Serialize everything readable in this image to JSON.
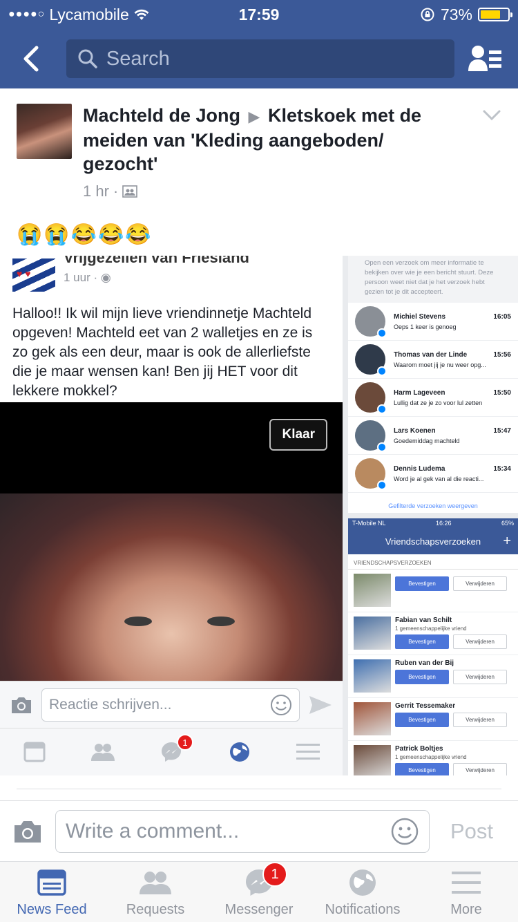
{
  "status_bar": {
    "carrier": "Lycamobile",
    "time": "17:59",
    "battery": "73%",
    "battery_level": 0.73
  },
  "nav": {
    "search_placeholder": "Search"
  },
  "post": {
    "author": "Machteld de Jong",
    "target": "Kletskoek met de meiden van 'Kleding aangeboden/ gezocht'",
    "time": "1 hr",
    "emojis": "😭😭😂😂😂"
  },
  "embedded_post": {
    "group": "Vrijgezellen van Friesland",
    "time": "1 uur",
    "text": "Halloo!! Ik wil mijn lieve vriendinnetje Machteld opgeven! Machteld eet van 2 walletjes en ze is zo gek als een deur, maar is ook de allerliefste die je maar wensen kan! Ben jij HET voor dit lekkere mokkel?",
    "klaar": "Klaar",
    "comment_placeholder": "Reactie schrijven...",
    "messenger_badge": "1"
  },
  "messages_panel": {
    "note": "Open een verzoek om meer informatie te bekijken over wie je een bericht stuurt. Deze persoon weet niet dat je het verzoek hebt gezien tot je dit accepteert.",
    "items": [
      {
        "name": "Michiel Stevens",
        "time": "16:05",
        "text": "Oeps 1 keer is genoeg",
        "color": "#8a8f96"
      },
      {
        "name": "Thomas van der Linde",
        "time": "15:56",
        "text": "Waarom moet jij je nu weer opg...",
        "color": "#2f3a4a"
      },
      {
        "name": "Harm Lageveen",
        "time": "15:50",
        "text": "Lullig dat ze je zo voor lul zetten",
        "color": "#6b4a3a"
      },
      {
        "name": "Lars Koenen",
        "time": "15:47",
        "text": "Goedemiddag machteld",
        "color": "#5d6f82"
      },
      {
        "name": "Dennis Ludema",
        "time": "15:34",
        "text": "Word je al gek van al die reacti...",
        "color": "#b98a60"
      }
    ],
    "filtered": "Gefilterde verzoeken weergeven"
  },
  "friends_panel": {
    "carrier": "T-Mobile NL",
    "time": "16:26",
    "battery": "65%",
    "title": "Vriendschapsverzoeken",
    "section": "VRIENDSCHAPSVERZOEKEN",
    "confirm": "Bevestigen",
    "delete": "Verwijderen",
    "items": [
      {
        "name": "",
        "mutual": "",
        "color": "#7b8a6a"
      },
      {
        "name": "Fabian van Schilt",
        "mutual": "1 gemeenschappelijke vriend",
        "color": "#4a6fa0"
      },
      {
        "name": "Ruben van der Bij",
        "mutual": "",
        "color": "#3f6fb0"
      },
      {
        "name": "Gerrit Tessemaker",
        "mutual": "",
        "color": "#a0553a"
      },
      {
        "name": "Patrick Boltjes",
        "mutual": "1 gemeenschappelijke vriend",
        "color": "#6a4a3a"
      }
    ]
  },
  "comment_bar": {
    "placeholder": "Write a comment...",
    "post": "Post"
  },
  "tabbar": {
    "news_feed": "News Feed",
    "requests": "Requests",
    "messenger": "Messenger",
    "notifications": "Notifications",
    "more": "More",
    "messenger_badge": "1"
  }
}
